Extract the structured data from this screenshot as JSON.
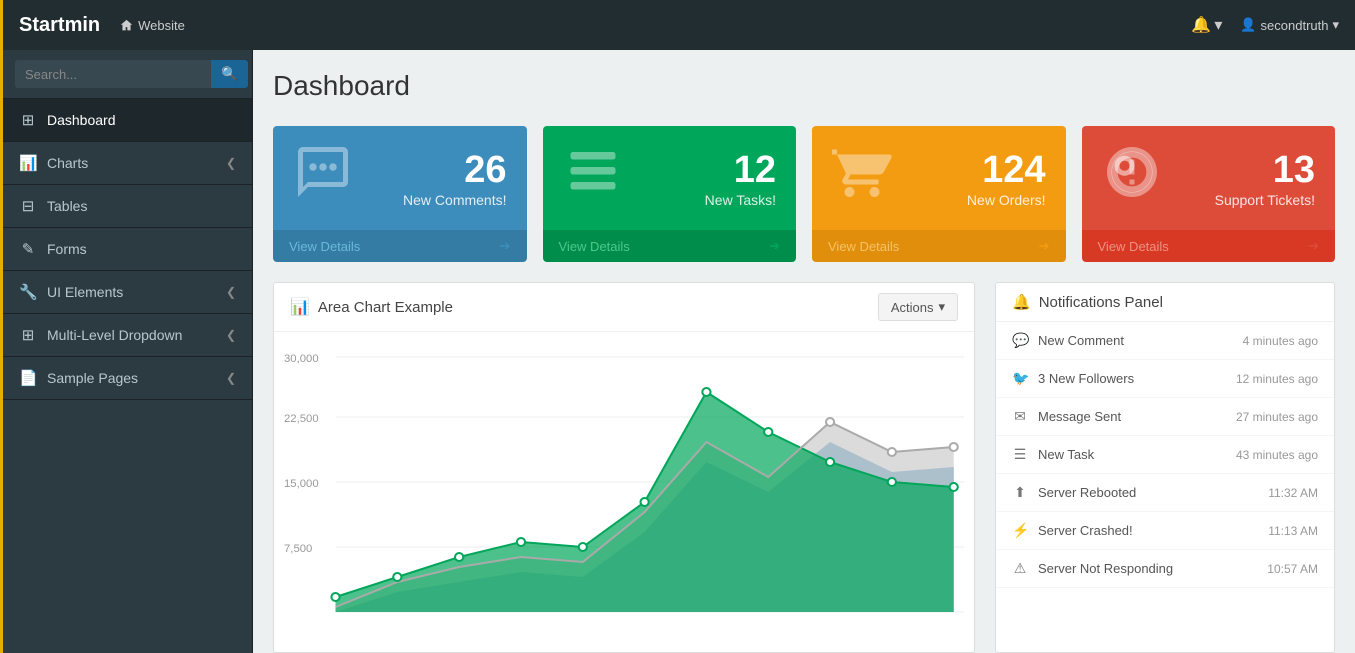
{
  "topnav": {
    "brand": "Startmin",
    "home_icon": "home-icon",
    "website_link": "Website",
    "bell_icon": "bell-icon",
    "caret_down": "▾",
    "user_icon": "user-icon",
    "username": "secondtruth"
  },
  "sidebar": {
    "search_placeholder": "Search...",
    "search_button_icon": "search-icon",
    "menu_items": [
      {
        "id": "dashboard",
        "label": "Dashboard",
        "icon": "dashboard-icon",
        "icon_char": "⊞",
        "active": true,
        "has_arrow": false
      },
      {
        "id": "charts",
        "label": "Charts",
        "icon": "charts-icon",
        "icon_char": "▦",
        "active": false,
        "has_arrow": true
      },
      {
        "id": "tables",
        "label": "Tables",
        "icon": "tables-icon",
        "icon_char": "⊟",
        "active": false,
        "has_arrow": false
      },
      {
        "id": "forms",
        "label": "Forms",
        "icon": "forms-icon",
        "icon_char": "✎",
        "active": false,
        "has_arrow": false
      },
      {
        "id": "ui-elements",
        "label": "UI Elements",
        "icon": "ui-icon",
        "icon_char": "🔧",
        "active": false,
        "has_arrow": true
      },
      {
        "id": "multilevel",
        "label": "Multi-Level Dropdown",
        "icon": "multilevel-icon",
        "icon_char": "⊞",
        "active": false,
        "has_arrow": true
      },
      {
        "id": "sample",
        "label": "Sample Pages",
        "icon": "sample-icon",
        "icon_char": "📄",
        "active": false,
        "has_arrow": true
      }
    ]
  },
  "main": {
    "page_title": "Dashboard",
    "stat_cards": [
      {
        "id": "comments",
        "number": "26",
        "label": "New Comments!",
        "view_details": "View Details",
        "color": "blue"
      },
      {
        "id": "tasks",
        "number": "12",
        "label": "New Tasks!",
        "view_details": "View Details",
        "color": "green"
      },
      {
        "id": "orders",
        "number": "124",
        "label": "New Orders!",
        "view_details": "View Details",
        "color": "orange"
      },
      {
        "id": "tickets",
        "number": "13",
        "label": "Support Tickets!",
        "view_details": "View Details",
        "color": "red"
      }
    ],
    "chart": {
      "title": "Area Chart Example",
      "actions_label": "Actions",
      "y_labels": [
        "30,000",
        "22,500",
        "15,000",
        "7,500"
      ],
      "chart_icon": "bar-chart-icon"
    },
    "notifications": {
      "title": "Notifications Panel",
      "bell_icon": "notifications-bell-icon",
      "items": [
        {
          "id": "new-comment",
          "icon": "comment-icon",
          "icon_char": "💬",
          "label": "New Comment",
          "time": "4 minutes ago"
        },
        {
          "id": "new-followers",
          "icon": "twitter-icon",
          "icon_char": "🐦",
          "label": "3 New Followers",
          "time": "12 minutes ago"
        },
        {
          "id": "message-sent",
          "icon": "envelope-icon",
          "icon_char": "✉",
          "label": "Message Sent",
          "time": "27 minutes ago"
        },
        {
          "id": "new-task",
          "icon": "task-icon",
          "icon_char": "☰",
          "label": "New Task",
          "time": "43 minutes ago"
        },
        {
          "id": "server-rebooted",
          "icon": "upload-icon",
          "icon_char": "⬆",
          "label": "Server Rebooted",
          "time": "11:32 AM"
        },
        {
          "id": "server-crashed",
          "icon": "bolt-icon",
          "icon_char": "⚡",
          "label": "Server Crashed!",
          "time": "11:13 AM"
        },
        {
          "id": "server-not-responding",
          "icon": "warning-icon",
          "icon_char": "⚠",
          "label": "Server Not Responding",
          "time": "10:57 AM"
        }
      ]
    }
  }
}
